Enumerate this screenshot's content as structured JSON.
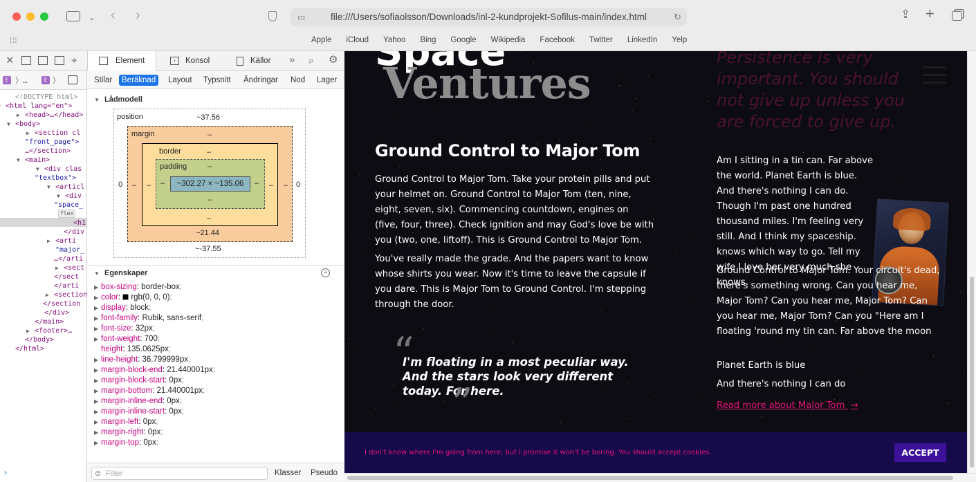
{
  "browser": {
    "url": "file:///Users/sofiaolsson/Downloads/inl-2-kundprojekt-Sofilus-main/index.html",
    "favorites": [
      "Apple",
      "iCloud",
      "Yahoo",
      "Bing",
      "Google",
      "Wikipedia",
      "Facebook",
      "Twitter",
      "LinkedIn",
      "Yelp"
    ]
  },
  "devtools": {
    "tabs": {
      "element": "Element",
      "console": "Konsol",
      "sources": "Källor"
    },
    "subtabs": [
      "Stilar",
      "Beräknad",
      "Layout",
      "Typsnitt",
      "Ändringar",
      "Nod",
      "Lager"
    ],
    "box_model": {
      "heading": "Lådmodell",
      "position_label": "position",
      "position_top": "~37.56",
      "position_bottom": "~-37.55",
      "position_left": "0",
      "position_right": "0",
      "margin_label": "margin",
      "margin_top": "–",
      "margin_bottom": "~21.44",
      "margin_left": "–",
      "margin_right": "–",
      "border_label": "border",
      "border_top": "–",
      "border_bottom": "–",
      "border_left": "–",
      "border_right": "–",
      "padding_label": "padding",
      "padding_top": "–",
      "padding_bottom": "–",
      "padding_left": "–",
      "padding_right": "–",
      "content": "~302.27 × ~135.06"
    },
    "properties_heading": "Egenskaper",
    "properties": [
      {
        "name": "box-sizing",
        "value": "border-box",
        "expandable": true
      },
      {
        "name": "color",
        "value": "rgb(0, 0, 0)",
        "expandable": true,
        "swatch": "#000000"
      },
      {
        "name": "display",
        "value": "block",
        "expandable": true
      },
      {
        "name": "font-family",
        "value": "Rubik, sans-serif",
        "expandable": true
      },
      {
        "name": "font-size",
        "value": "32px",
        "expandable": true
      },
      {
        "name": "font-weight",
        "value": "700",
        "expandable": true
      },
      {
        "name": "height",
        "value": "135.0625px",
        "expandable": false
      },
      {
        "name": "line-height",
        "value": "36.799999px",
        "expandable": true
      },
      {
        "name": "margin-block-end",
        "value": "21.440001px",
        "expandable": true
      },
      {
        "name": "margin-block-start",
        "value": "0px",
        "expandable": true
      },
      {
        "name": "margin-bottom",
        "value": "21.440001px",
        "expandable": true
      },
      {
        "name": "margin-inline-end",
        "value": "0px",
        "expandable": true
      },
      {
        "name": "margin-inline-start",
        "value": "0px",
        "expandable": true
      },
      {
        "name": "margin-left",
        "value": "0px",
        "expandable": true
      },
      {
        "name": "margin-right",
        "value": "0px",
        "expandable": true
      },
      {
        "name": "margin-top",
        "value": "0px",
        "expandable": true
      }
    ],
    "filter_placeholder": "Filter",
    "classes_label": "Klasser",
    "pseudo_label": "Pseudo",
    "dom_lines": [
      "<!DOCTYPE html>",
      "<html lang=\"en\">",
      "<head>…</head>",
      "<body>",
      "<section cl",
      "\"front_page\">",
      "…</section>",
      "<main>",
      "<div clas",
      "\"textbox\">",
      "<articl",
      "<div",
      "\"space_",
      "flex",
      "<h1",
      "</div",
      "<arti",
      "\"major_",
      "…</arti",
      "<sect",
      "</sect",
      "</arti",
      "<section",
      "</section",
      "</div>",
      "</main>",
      "<footer>…",
      "</body>",
      "</html>"
    ]
  },
  "page": {
    "brand_line1": "Space",
    "brand_line2": "Ventures",
    "persistence_quote": "Persistence is very important. You should not give up unless you are forced to give up.",
    "heading": "Ground Control to Major Tom",
    "para1": "Ground Control to Major Tom. Take your protein pills and put your helmet on. Ground Control to Major Tom (ten, nine, eight, seven, six). Commencing countdown, engines on (five, four, three). Check ignition and may God's love be with you (two, one, liftoff). This is Ground Control to Major Tom.",
    "para2": "You've really made the grade. And the papers want to know whose shirts you wear. Now it's time to leave the capsule if you dare. This is Major Tom to Ground Control. I'm stepping through the door.",
    "quote": "I'm floating in a most peculiar way. And the stars look very different today. For here.",
    "right_p1": "Am I sitting in a tin can. Far above the world. Planet Earth is blue. And there's nothing I can do. Though I'm past one hundred thousand miles. I'm feeling very still. And I think my spaceship. knows which way to go. Tell my wife I love her very much she knows.",
    "right_p2": "Ground Control to Major Tom. Your circuit's dead, there's something wrong. Can you hear me, Major Tom? Can you hear me, Major Tom? Can you hear me, Major Tom? Can you \"Here am I floating 'round my tin can. Far above the moon",
    "right_p3": "Planet Earth is blue",
    "right_p4": "And there's nothing I can do",
    "read_more": "Read more about Major Tom",
    "cookie_text": "I don't know where I'm going from here, but I promise it won't be boring. You should accept cookies.",
    "accept": "ACCEPT"
  },
  "colors": {
    "accent_pink": "#e6157a",
    "cookie_bg": "#150a4a",
    "accept_bg": "#3b1299",
    "devtools_select": "#1a73e8"
  }
}
